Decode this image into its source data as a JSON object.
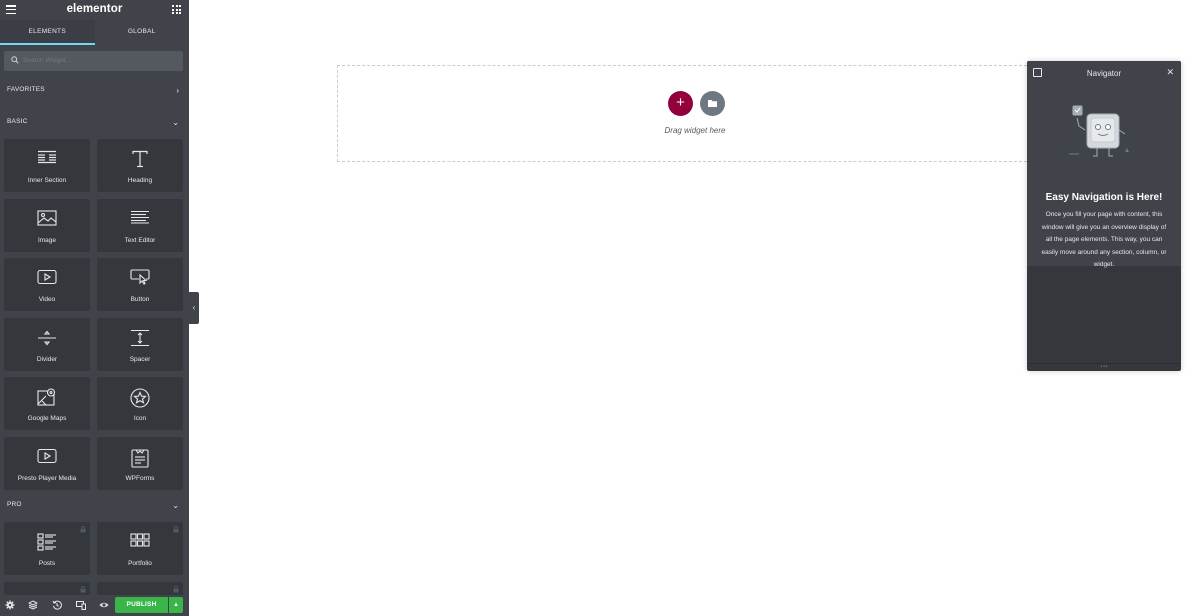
{
  "header": {
    "logo": "elementor"
  },
  "tabs": [
    {
      "label": "ELEMENTS",
      "active": true
    },
    {
      "label": "GLOBAL",
      "active": false
    }
  ],
  "search": {
    "placeholder": "Search Widget..."
  },
  "sections": {
    "favorites": "FAVORITES",
    "basic": "BASIC",
    "pro": "PRO"
  },
  "widgets": {
    "basic": [
      {
        "label": "Inner Section",
        "icon": "inner-section-icon"
      },
      {
        "label": "Heading",
        "icon": "heading-icon"
      },
      {
        "label": "Image",
        "icon": "image-icon"
      },
      {
        "label": "Text Editor",
        "icon": "text-editor-icon"
      },
      {
        "label": "Video",
        "icon": "video-icon"
      },
      {
        "label": "Button",
        "icon": "button-icon"
      },
      {
        "label": "Divider",
        "icon": "divider-icon"
      },
      {
        "label": "Spacer",
        "icon": "spacer-icon"
      },
      {
        "label": "Google Maps",
        "icon": "google-maps-icon"
      },
      {
        "label": "Icon",
        "icon": "star-icon"
      },
      {
        "label": "Presto Player Media",
        "icon": "video-icon"
      },
      {
        "label": "WPForms",
        "icon": "wpforms-icon"
      }
    ],
    "pro": [
      {
        "label": "Posts",
        "icon": "posts-icon",
        "locked": true
      },
      {
        "label": "Portfolio",
        "icon": "portfolio-icon",
        "locked": true
      }
    ]
  },
  "footer": {
    "publish_label": "PUBLISH"
  },
  "canvas": {
    "drag_text": "Drag widget here"
  },
  "navigator": {
    "title": "Navigator",
    "heading": "Easy Navigation is Here!",
    "text": "Once you fill your page with content, this window will give you an overview display of all the page elements. This way, you can easily move around any section, column, or widget."
  },
  "colors": {
    "panel_bg": "#404349",
    "widget_bg": "#34383c",
    "tab_accent": "#71d7f7",
    "add_button": "#93003c",
    "template_button": "#6d7882",
    "publish": "#39b54a"
  }
}
